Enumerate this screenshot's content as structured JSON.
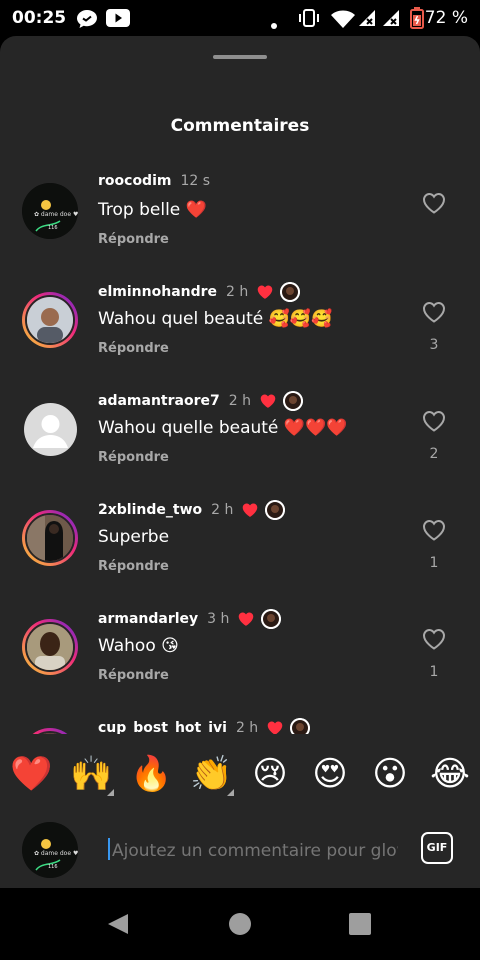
{
  "status_bar": {
    "time": "00:25",
    "battery": "72 %"
  },
  "sheet": {
    "title": "Commentaires"
  },
  "comments": [
    {
      "username": "roocodim",
      "time": "12 s",
      "text": "Trop belle ❤️",
      "reply": "Répondre",
      "likes": "",
      "creator_liked": false
    },
    {
      "username": "elminnohandre",
      "time": "2 h",
      "text": "Wahou quel beauté 🥰🥰🥰",
      "reply": "Répondre",
      "likes": "3",
      "creator_liked": true
    },
    {
      "username": "adamantraore7",
      "time": "2 h",
      "text": "Wahou quelle beauté ❤️❤️❤️",
      "reply": "Répondre",
      "likes": "2",
      "creator_liked": true
    },
    {
      "username": "2xblinde_two",
      "time": "2 h",
      "text": "Superbe",
      "reply": "Répondre",
      "likes": "1",
      "creator_liked": true
    },
    {
      "username": "armandarley",
      "time": "3 h",
      "text": "Wahoo 😘",
      "reply": "Répondre",
      "likes": "1",
      "creator_liked": true
    },
    {
      "username": "cup_bost_hot_ivi",
      "time": "2 h",
      "text": "",
      "reply": "",
      "likes": "",
      "creator_liked": true
    }
  ],
  "emoji_bar": [
    "❤️",
    "🙌",
    "🔥",
    "👏",
    "😢",
    "😍",
    "😮",
    "😂"
  ],
  "composer": {
    "placeholder": "Ajoutez un commentaire pour glow_",
    "gif_label": "GIF"
  },
  "colors": {
    "background": "#262626",
    "like_red": "#ff3040",
    "accent": "#3897f0",
    "muted": "#a8a8a8"
  }
}
